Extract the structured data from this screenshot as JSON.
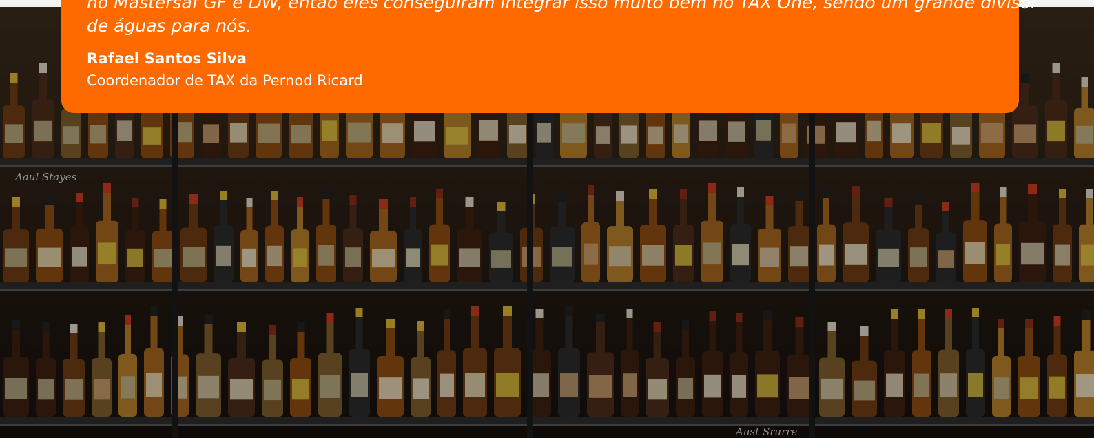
{
  "testimonial": {
    "quote_line1": "no Mastersaf GF e DW, então eles conseguiram integrar isso muito bem no TAX One, sendo um grande divisor",
    "quote_line2": "de águas para nós.",
    "author_name": "Rafael Santos Silva",
    "author_role": "Coordenador de TAX da Pernod Ricard"
  },
  "background": {
    "image_name": "liquor-store-shelves-photo",
    "sign_left": "Aaul Stayes",
    "sign_bottom": "Aust Srurre"
  },
  "colors": {
    "card": "#ff6a00",
    "text": "#ffffff",
    "overlay": "#1a1816"
  }
}
